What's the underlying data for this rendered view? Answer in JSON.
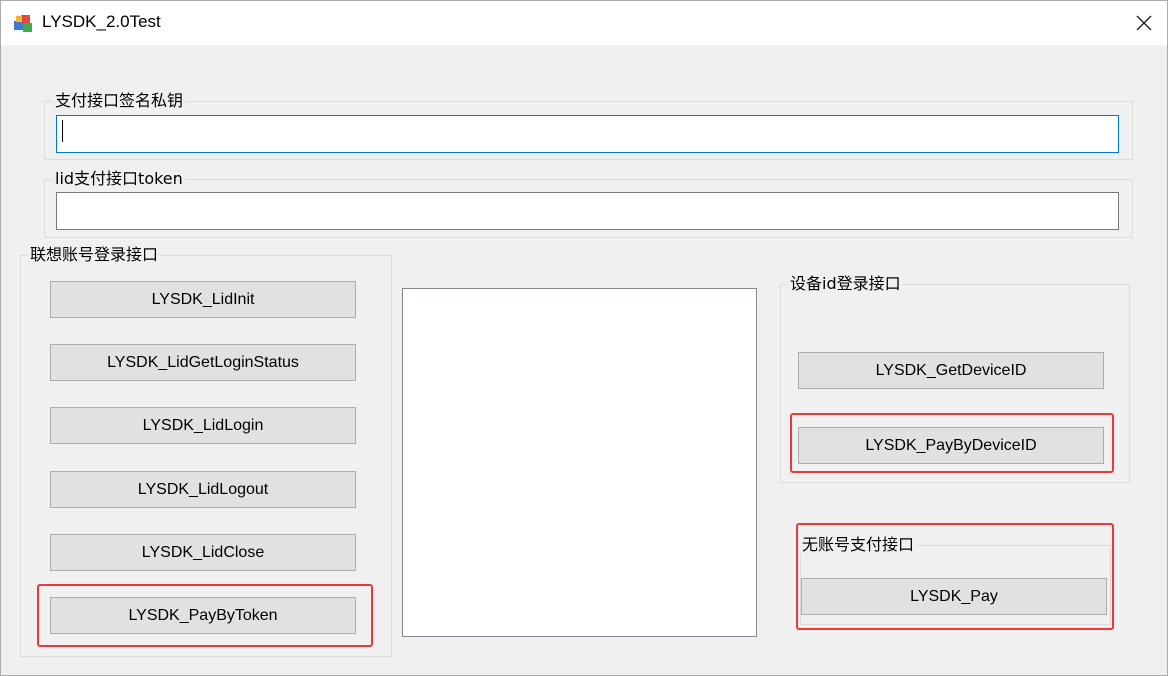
{
  "window": {
    "title": "LYSDK_2.0Test"
  },
  "pay_key_group": {
    "label": "支付接口签名私钥",
    "value": ""
  },
  "token_group": {
    "label": "lid支付接口token",
    "value": ""
  },
  "lenovo_login_group": {
    "label": "联想账号登录接口",
    "buttons": [
      "LYSDK_LidInit",
      "LYSDK_LidGetLoginStatus",
      "LYSDK_LidLogin",
      "LYSDK_LidLogout",
      "LYSDK_LidClose",
      "LYSDK_PayByToken"
    ]
  },
  "device_login_group": {
    "label": "设备id登录接口",
    "buttons": [
      "LYSDK_GetDeviceID",
      "LYSDK_PayByDeviceID"
    ]
  },
  "no_account_pay_group": {
    "label": "无账号支付接口",
    "buttons": [
      "LYSDK_Pay"
    ]
  },
  "highlight_color": "#e83a3a"
}
